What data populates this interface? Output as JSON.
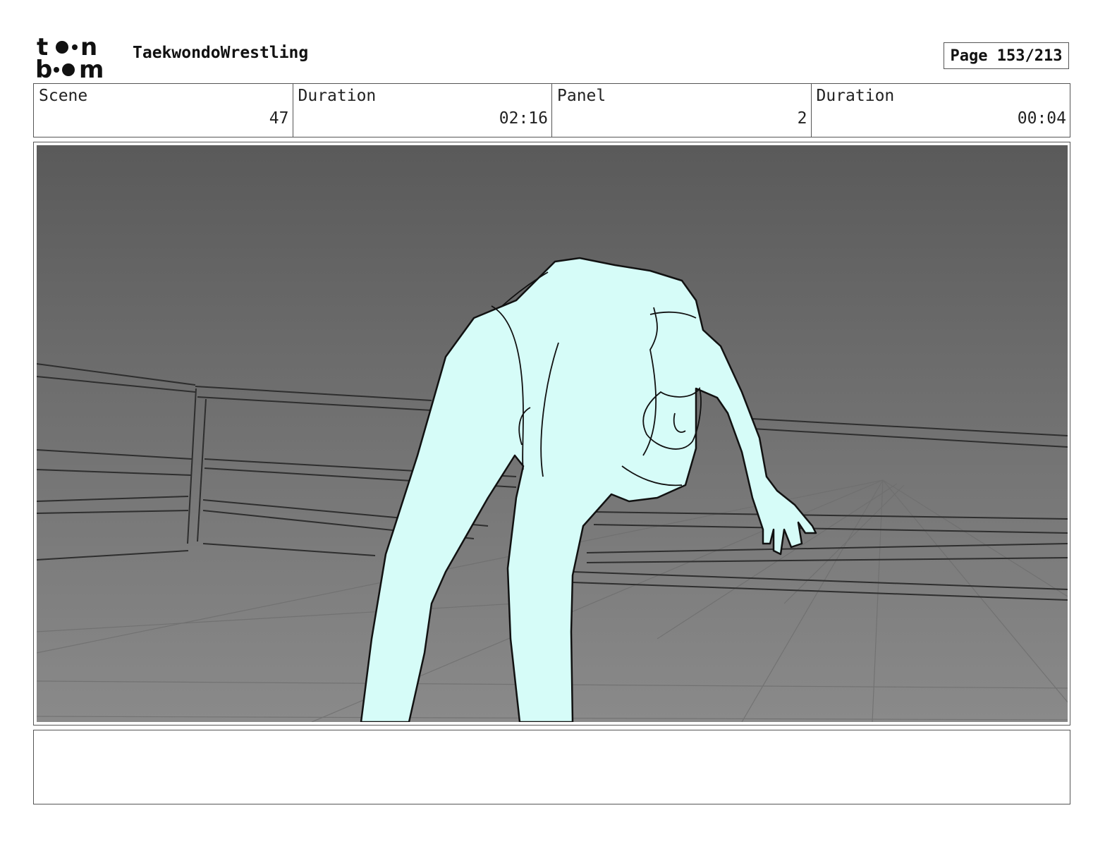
{
  "header": {
    "logo_top": "toon",
    "logo_bottom": "boom",
    "project_title": "TaekwondoWrestling",
    "page_label": "Page 153/213"
  },
  "info": {
    "scene_label": "Scene",
    "scene_value": "47",
    "scene_duration_label": "Duration",
    "scene_duration_value": "02:16",
    "panel_label": "Panel",
    "panel_value": "2",
    "panel_duration_label": "Duration",
    "panel_duration_value": "00:04"
  },
  "panel": {
    "background_top": "#5a5a5a",
    "background_bottom": "#8a8a8a",
    "figure_fill": "#d6fcf8"
  },
  "notes": {
    "text": ""
  }
}
